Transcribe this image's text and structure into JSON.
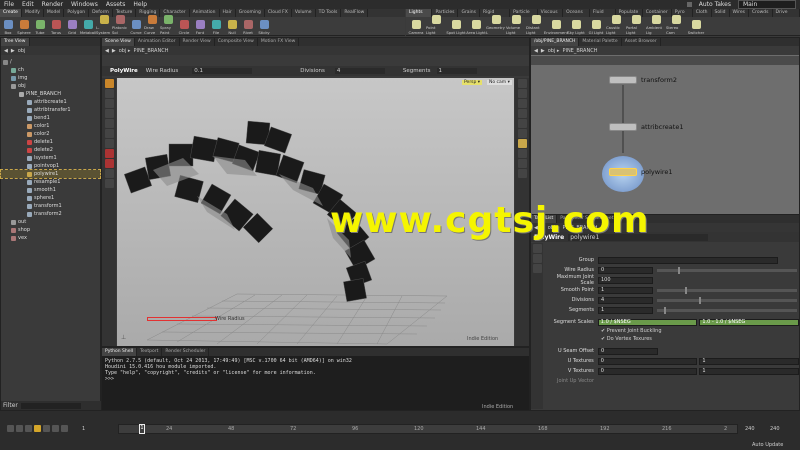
{
  "menu": {
    "items": [
      "File",
      "Edit",
      "Render",
      "Windows",
      "Assets",
      "Help"
    ],
    "right_label": "Auto Takes",
    "right_field": "Main"
  },
  "shelf_tabs_left": [
    "Create",
    "Modify",
    "Model",
    "Polygon",
    "Deform",
    "Texture",
    "Rigging",
    "Character",
    "Animation",
    "Hair",
    "Grooming",
    "Cloud FX",
    "Volume",
    "TD Tools",
    "RealFlow"
  ],
  "shelf_tabs_right": [
    "Lights and",
    "Particles",
    "Grains",
    "Rigid Bodies",
    "Particle Flu",
    "Viscous Fl",
    "Oceans FX",
    "Fluid Cont",
    "Populate C",
    "Container",
    "Pyro FX",
    "Cloth",
    "Solid",
    "Wires",
    "Crowds",
    "Drive Simu"
  ],
  "tools_left": [
    "Box",
    "Sphere",
    "Tube",
    "Torus",
    "Grid",
    "Metaball",
    "L-System",
    "Platonic Sol",
    "Curve",
    "Draw Curve",
    "Spray Paint",
    "Circle",
    "Font",
    "File",
    "Null",
    "Rivet",
    "Sticky"
  ],
  "tools_right": [
    "Camera",
    "Point Light",
    "Spot Light",
    "Area Light",
    "Geometry L",
    "Volume Light",
    "Distant Light",
    "Environment",
    "Sky Light",
    "GI Light",
    "Caustic Light",
    "Portal Light",
    "Ambient Lig",
    "Stereo Cam",
    "Switcher"
  ],
  "tree": {
    "tab": "Tree View",
    "path": "obj",
    "items": [
      {
        "label": "/",
        "indent": 0,
        "color": "#888"
      },
      {
        "label": "ch",
        "indent": 1,
        "color": "#7a9"
      },
      {
        "label": "img",
        "indent": 1,
        "color": "#79a"
      },
      {
        "label": "obj",
        "indent": 1,
        "color": "#999"
      },
      {
        "label": "PINE_BRANCH",
        "indent": 2,
        "color": "#aaa"
      },
      {
        "label": "attribcreate1",
        "indent": 3,
        "color": "#9ab"
      },
      {
        "label": "attribtransfer1",
        "indent": 3,
        "color": "#9ab"
      },
      {
        "label": "bend1",
        "indent": 3,
        "color": "#9ab"
      },
      {
        "label": "color1",
        "indent": 3,
        "color": "#c96"
      },
      {
        "label": "color2",
        "indent": 3,
        "color": "#c96"
      },
      {
        "label": "delete1",
        "indent": 3,
        "color": "#c44"
      },
      {
        "label": "delete2",
        "indent": 3,
        "color": "#c44"
      },
      {
        "label": "lsystem1",
        "indent": 3,
        "color": "#9ab"
      },
      {
        "label": "pointvop1",
        "indent": 3,
        "color": "#9ab"
      },
      {
        "label": "polywire1",
        "indent": 3,
        "color": "#c9a74a",
        "selected": true
      },
      {
        "label": "resample1",
        "indent": 3,
        "color": "#9ab"
      },
      {
        "label": "smooth1",
        "indent": 3,
        "color": "#9ab"
      },
      {
        "label": "sphere1",
        "indent": 3,
        "color": "#9ab"
      },
      {
        "label": "transform1",
        "indent": 3,
        "color": "#9ab"
      },
      {
        "label": "transform2",
        "indent": 3,
        "color": "#9ab"
      },
      {
        "label": "out",
        "indent": 1,
        "color": "#999"
      },
      {
        "label": "shop",
        "indent": 1,
        "color": "#a77"
      },
      {
        "label": "vex",
        "indent": 1,
        "color": "#a77"
      }
    ],
    "filter_label": "Filter"
  },
  "viewport": {
    "tabs": [
      "Scene View",
      "Animation Editor",
      "Render View",
      "Composite View",
      "Motion FX View"
    ],
    "path": "PINE_BRANCH",
    "tool_label": "PolyWire",
    "wire_radius_label": "Wire Radius",
    "wire_radius_value": "0.1",
    "divisions_label": "Divisions",
    "divisions_value": "4",
    "segments_label": "Segments",
    "segments_value": "1",
    "badge": "Indie Edition",
    "hud_label": "Wire Radius",
    "top_right_labels": [
      "Persp ▾",
      "No cam ▾"
    ]
  },
  "network": {
    "tabs": [
      "/obj/PINE_BRANCH",
      "Material Palette",
      "Asset Browser"
    ],
    "path": "PINE_BRANCH",
    "nodes": [
      "transform2",
      "attribcreate1",
      "polywire1"
    ]
  },
  "params": {
    "tabs": [
      "Take List",
      "Parameter Spreadsheet"
    ],
    "path": "PINE_BRANCH",
    "node_type": "PolyWire",
    "node_name": "polywire1",
    "rows": [
      {
        "label": "Group",
        "value": ""
      },
      {
        "label": "Wire Radius",
        "value": "0",
        "slider": 0.15
      },
      {
        "label": "Maximum Joint Scale",
        "value": "100"
      },
      {
        "label": "Smooth Point",
        "value": "1",
        "slider": 0.2
      },
      {
        "label": "Divisions",
        "value": "4",
        "slider": 0.3
      },
      {
        "label": "Segments",
        "value": "1",
        "slider": 0.05
      }
    ],
    "segment_scales_label": "Segment Scales",
    "segment_scales_values": [
      "1.0 / $NSEG",
      "1.0 - 1.0 / $NSEG"
    ],
    "checks": [
      "Prevent Joint Buckling",
      "Do Vertex Texures"
    ],
    "u_seam_label": "U Seam Offset",
    "u_seam_value": "0",
    "u_textures_label": "U Textures",
    "u_textures_values": [
      "0",
      "1"
    ],
    "v_textures_label": "V Textures",
    "v_textures_values": [
      "0",
      "1"
    ],
    "joint_up_label": "Joint Up Vector"
  },
  "console": {
    "tabs": [
      "Python Shell",
      "Textport",
      "Render Scheduler"
    ],
    "lines": [
      "Python 2.7.5 (default, Oct 24 2013, 17:49:49) [MSC v.1700 64 bit (AMD64)] on win32",
      "Houdini 15.0.416 hou module imported.",
      "Type \"help\", \"copyright\", \"credits\" or \"license\" for more information.",
      ">>>"
    ],
    "badge": "Indie Edition"
  },
  "timeline": {
    "frame": "1",
    "start": "1",
    "ticks": [
      "24",
      "48",
      "72",
      "96",
      "120",
      "144",
      "168",
      "192",
      "216",
      "2"
    ],
    "end": "240",
    "end2": "240",
    "auto_update": "Auto Update"
  },
  "watermark": "www.cgtsj.com",
  "colors": {
    "accent": "#c9a74a",
    "selection": "#ffd24a",
    "watermark": "#f5f500"
  }
}
